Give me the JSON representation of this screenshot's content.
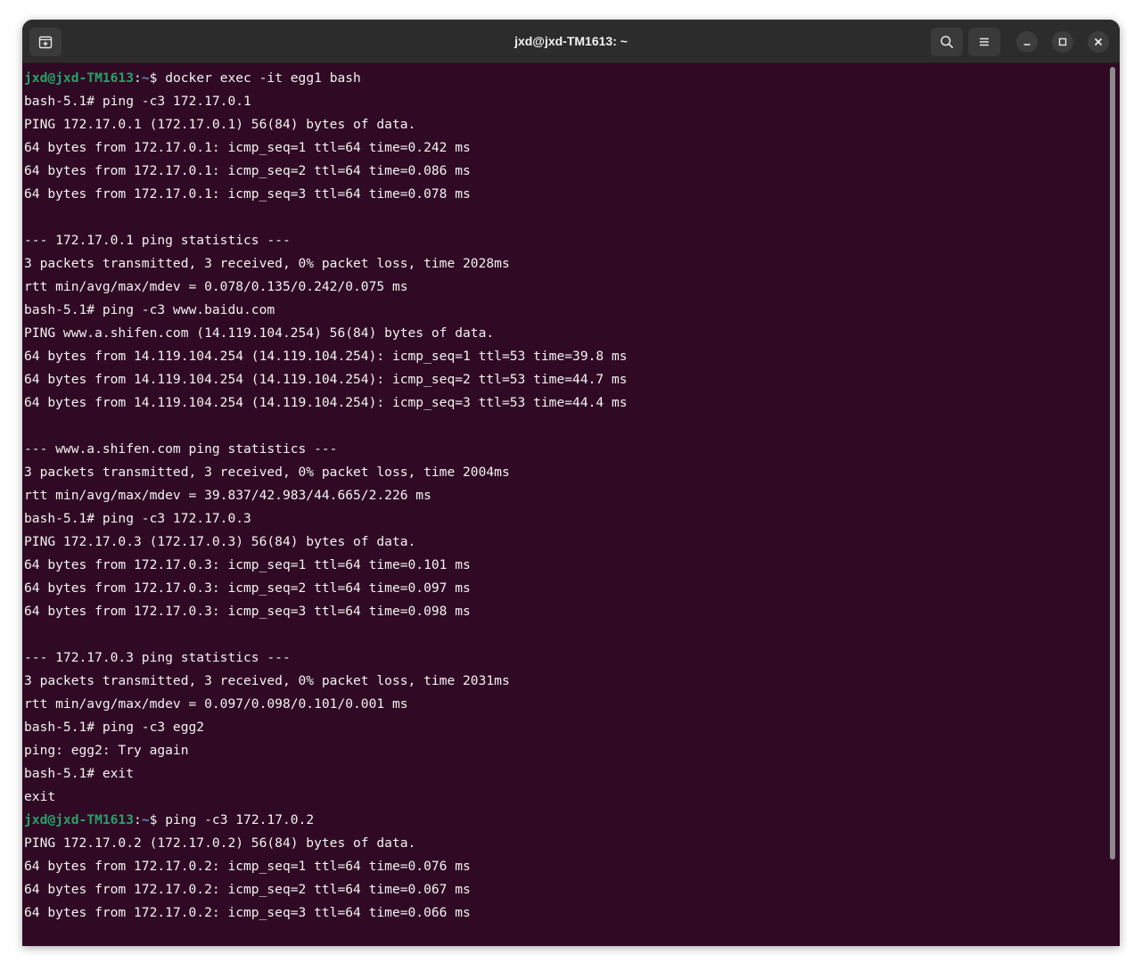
{
  "window": {
    "title": "jxd@jxd-TM1613: ~"
  },
  "titlebar": {
    "new_tab_icon": "new-tab-icon",
    "search_icon": "search-icon",
    "menu_icon": "hamburger-menu-icon",
    "minimize_icon": "minimize-icon",
    "maximize_icon": "maximize-icon",
    "close_icon": "close-icon"
  },
  "colors": {
    "terminal_bg": "#300a24",
    "prompt_user": "#26a269",
    "prompt_path": "#5c8dc9",
    "text": "#f2f2f2",
    "titlebar_bg": "#2c2c2c"
  },
  "terminal": {
    "lines": [
      {
        "type": "prompt",
        "user": "jxd@jxd-TM1613",
        "colon": ":",
        "path": "~",
        "dollar": "$ ",
        "cmd": "docker exec -it egg1 bash"
      },
      {
        "type": "text",
        "text": "bash-5.1# ping -c3 172.17.0.1"
      },
      {
        "type": "text",
        "text": "PING 172.17.0.1 (172.17.0.1) 56(84) bytes of data."
      },
      {
        "type": "text",
        "text": "64 bytes from 172.17.0.1: icmp_seq=1 ttl=64 time=0.242 ms"
      },
      {
        "type": "text",
        "text": "64 bytes from 172.17.0.1: icmp_seq=2 ttl=64 time=0.086 ms"
      },
      {
        "type": "text",
        "text": "64 bytes from 172.17.0.1: icmp_seq=3 ttl=64 time=0.078 ms"
      },
      {
        "type": "text",
        "text": ""
      },
      {
        "type": "text",
        "text": "--- 172.17.0.1 ping statistics ---"
      },
      {
        "type": "text",
        "text": "3 packets transmitted, 3 received, 0% packet loss, time 2028ms"
      },
      {
        "type": "text",
        "text": "rtt min/avg/max/mdev = 0.078/0.135/0.242/0.075 ms"
      },
      {
        "type": "text",
        "text": "bash-5.1# ping -c3 www.baidu.com"
      },
      {
        "type": "text",
        "text": "PING www.a.shifen.com (14.119.104.254) 56(84) bytes of data."
      },
      {
        "type": "text",
        "text": "64 bytes from 14.119.104.254 (14.119.104.254): icmp_seq=1 ttl=53 time=39.8 ms"
      },
      {
        "type": "text",
        "text": "64 bytes from 14.119.104.254 (14.119.104.254): icmp_seq=2 ttl=53 time=44.7 ms"
      },
      {
        "type": "text",
        "text": "64 bytes from 14.119.104.254 (14.119.104.254): icmp_seq=3 ttl=53 time=44.4 ms"
      },
      {
        "type": "text",
        "text": ""
      },
      {
        "type": "text",
        "text": "--- www.a.shifen.com ping statistics ---"
      },
      {
        "type": "text",
        "text": "3 packets transmitted, 3 received, 0% packet loss, time 2004ms"
      },
      {
        "type": "text",
        "text": "rtt min/avg/max/mdev = 39.837/42.983/44.665/2.226 ms"
      },
      {
        "type": "text",
        "text": "bash-5.1# ping -c3 172.17.0.3"
      },
      {
        "type": "text",
        "text": "PING 172.17.0.3 (172.17.0.3) 56(84) bytes of data."
      },
      {
        "type": "text",
        "text": "64 bytes from 172.17.0.3: icmp_seq=1 ttl=64 time=0.101 ms"
      },
      {
        "type": "text",
        "text": "64 bytes from 172.17.0.3: icmp_seq=2 ttl=64 time=0.097 ms"
      },
      {
        "type": "text",
        "text": "64 bytes from 172.17.0.3: icmp_seq=3 ttl=64 time=0.098 ms"
      },
      {
        "type": "text",
        "text": ""
      },
      {
        "type": "text",
        "text": "--- 172.17.0.3 ping statistics ---"
      },
      {
        "type": "text",
        "text": "3 packets transmitted, 3 received, 0% packet loss, time 2031ms"
      },
      {
        "type": "text",
        "text": "rtt min/avg/max/mdev = 0.097/0.098/0.101/0.001 ms"
      },
      {
        "type": "text",
        "text": "bash-5.1# ping -c3 egg2"
      },
      {
        "type": "text",
        "text": "ping: egg2: Try again"
      },
      {
        "type": "text",
        "text": "bash-5.1# exit"
      },
      {
        "type": "text",
        "text": "exit"
      },
      {
        "type": "prompt",
        "user": "jxd@jxd-TM1613",
        "colon": ":",
        "path": "~",
        "dollar": "$ ",
        "cmd": "ping -c3 172.17.0.2"
      },
      {
        "type": "text",
        "text": "PING 172.17.0.2 (172.17.0.2) 56(84) bytes of data."
      },
      {
        "type": "text",
        "text": "64 bytes from 172.17.0.2: icmp_seq=1 ttl=64 time=0.076 ms"
      },
      {
        "type": "text",
        "text": "64 bytes from 172.17.0.2: icmp_seq=2 ttl=64 time=0.067 ms"
      },
      {
        "type": "text",
        "text": "64 bytes from 172.17.0.2: icmp_seq=3 ttl=64 time=0.066 ms"
      }
    ]
  }
}
